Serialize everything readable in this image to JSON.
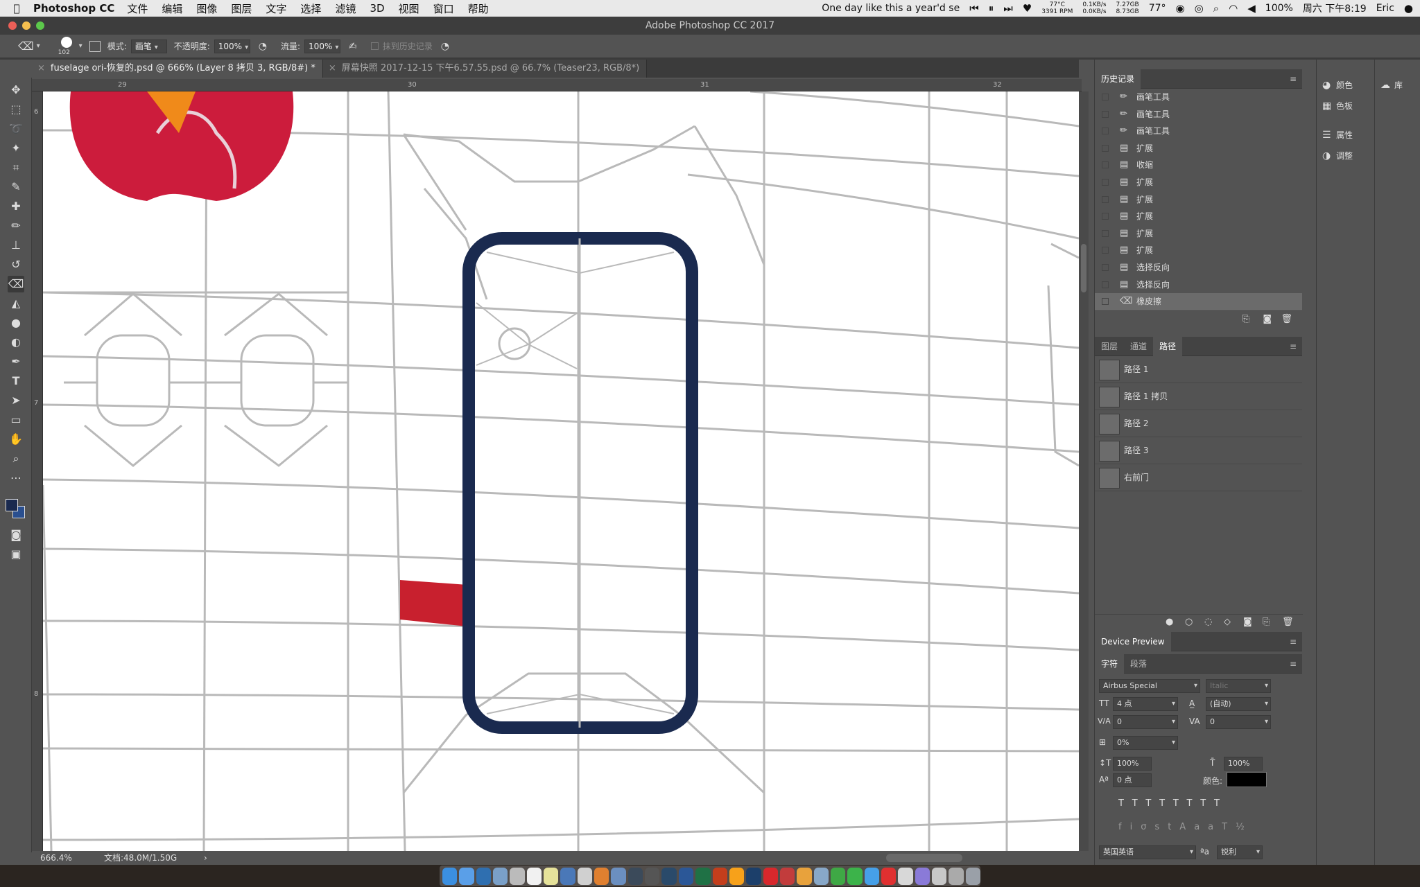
{
  "menubar": {
    "app": "Photoshop CC",
    "menus": [
      "文件",
      "编辑",
      "图像",
      "图层",
      "文字",
      "选择",
      "滤镜",
      "3D",
      "视图",
      "窗口",
      "帮助"
    ],
    "now_playing": "One day like this a year'd se",
    "cpu_temp": "77°C",
    "fan_rpm": "3391 RPM",
    "net_up": "0.1KB/s",
    "net_down": "0.0KB/s",
    "mem_used": "7.27GB",
    "mem_free": "8.73GB",
    "weather": "77°",
    "battery": "100%",
    "datetime": "周六 下午8:19",
    "user": "Eric"
  },
  "window": {
    "title": "Adobe Photoshop CC 2017"
  },
  "options": {
    "brush_size": "102",
    "mode_label": "模式:",
    "mode_value": "画笔",
    "opacity_label": "不透明度:",
    "opacity_value": "100%",
    "flow_label": "流量:",
    "flow_value": "100%",
    "erase_history": "抹到历史记录"
  },
  "tabs": [
    {
      "label": "fuselage ori-恢复的.psd @ 666% (Layer 8 拷贝 3, RGB/8#) *"
    },
    {
      "label": "屏幕快照 2017-12-15 下午6.57.55.psd @ 66.7% (Teaser23, RGB/8*)"
    }
  ],
  "rulers": {
    "h": [
      "29",
      "30",
      "31",
      "32"
    ],
    "v": [
      "6",
      "7",
      "8"
    ]
  },
  "status": {
    "zoom": "666.4%",
    "doc": "文档:48.0M/1.50G"
  },
  "history": {
    "title": "历史记录",
    "items": [
      {
        "label": "画笔工具",
        "icon": "brush"
      },
      {
        "label": "画笔工具",
        "icon": "brush"
      },
      {
        "label": "画笔工具",
        "icon": "brush"
      },
      {
        "label": "扩展",
        "icon": "doc"
      },
      {
        "label": "收缩",
        "icon": "doc"
      },
      {
        "label": "扩展",
        "icon": "doc"
      },
      {
        "label": "扩展",
        "icon": "doc"
      },
      {
        "label": "扩展",
        "icon": "doc"
      },
      {
        "label": "扩展",
        "icon": "doc"
      },
      {
        "label": "扩展",
        "icon": "doc"
      },
      {
        "label": "选择反向",
        "icon": "doc"
      },
      {
        "label": "选择反向",
        "icon": "doc"
      },
      {
        "label": "橡皮擦",
        "icon": "eraser"
      }
    ]
  },
  "paths_panel": {
    "tabs": [
      "图层",
      "通道",
      "路径"
    ],
    "items": [
      "路径 1",
      "路径 1 拷贝",
      "路径 2",
      "路径 3",
      "右前门"
    ]
  },
  "device_preview": {
    "title": "Device Preview"
  },
  "character": {
    "tabs": [
      "字符",
      "段落"
    ],
    "font_family": "Airbus Special",
    "font_style": "Italic",
    "size": "4 点",
    "leading": "(自动)",
    "kerning": "0",
    "tracking": "0",
    "scale_pct": "0%",
    "vscale": "100%",
    "hscale": "100%",
    "baseline": "0 点",
    "color_label": "颜色:",
    "language": "英国英语",
    "antialias_label": "ªa",
    "antialias": "锐利"
  },
  "mini_panels": {
    "col1": [
      "颜色",
      "色板",
      "属性",
      "调整"
    ],
    "col2": [
      "库"
    ]
  },
  "colors": {
    "accent_navy": "#1a2a4f",
    "logo_red": "#cc1c3c",
    "stripe_red": "#c8202e"
  }
}
